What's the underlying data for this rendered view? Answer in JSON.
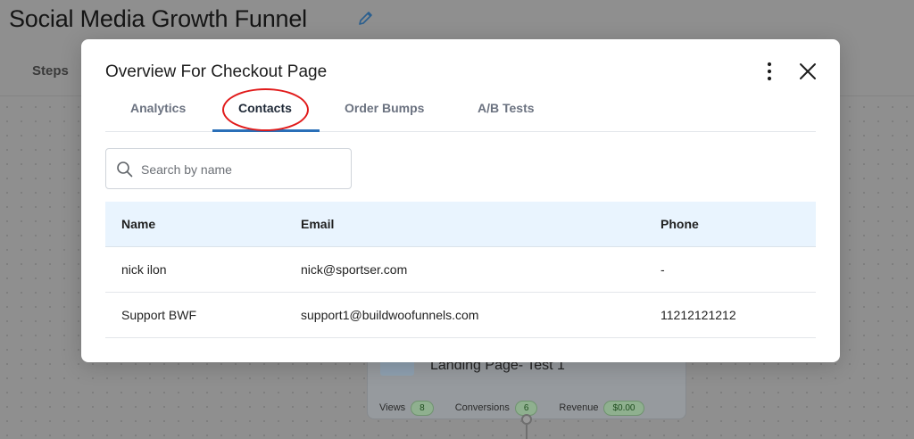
{
  "background": {
    "funnel_title": "Social Media Growth Funnel",
    "steps_tab": "Steps",
    "card": {
      "title": "Landing Page- Test 1",
      "stats": [
        {
          "label": "Views",
          "value": "8"
        },
        {
          "label": "Conversions",
          "value": "6"
        },
        {
          "label": "Revenue",
          "value": "$0.00"
        }
      ]
    }
  },
  "modal": {
    "title": "Overview For Checkout Page",
    "tabs": [
      {
        "label": "Analytics",
        "active": false
      },
      {
        "label": "Contacts",
        "active": true
      },
      {
        "label": "Order Bumps",
        "active": false
      },
      {
        "label": "A/B Tests",
        "active": false
      }
    ],
    "search": {
      "placeholder": "Search by name",
      "value": ""
    },
    "table": {
      "headers": [
        "Name",
        "Email",
        "Phone"
      ],
      "rows": [
        [
          "nick ilon",
          "nick@sportser.com",
          "-"
        ],
        [
          "Support BWF",
          "support1@buildwoofunnels.com",
          "11212121212"
        ]
      ]
    }
  },
  "icons": {
    "edit": "pencil-icon",
    "more": "more-vertical-icon",
    "close": "close-icon",
    "search": "search-icon"
  },
  "colors": {
    "accent": "#2a6fb8",
    "highlight_circle": "#e11b1b",
    "table_header_bg": "#e9f4fe"
  }
}
